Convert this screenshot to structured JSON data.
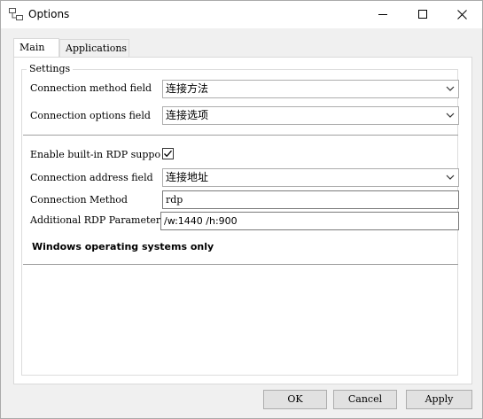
{
  "window": {
    "title": "Options"
  },
  "tabs": [
    {
      "label": "Main"
    },
    {
      "label": "Applications"
    }
  ],
  "settings": {
    "group_title": "Settings",
    "connection_method_field": {
      "label": "Connection method field",
      "value": "连接方法"
    },
    "connection_options_field": {
      "label": "Connection options field",
      "value": "连接选项"
    },
    "enable_rdp": {
      "label": "Enable built-in RDP suppo",
      "checked": true
    },
    "connection_address_field": {
      "label": "Connection address field",
      "value": "连接地址"
    },
    "connection_method": {
      "label": "Connection Method",
      "value": "rdp"
    },
    "additional_rdp_parameter": {
      "label": "Additional RDP Parameter",
      "value": "/w:1440 /h:900"
    },
    "note": "Windows operating systems only"
  },
  "buttons": {
    "ok": "OK",
    "cancel": "Cancel",
    "apply": "Apply"
  },
  "icons": {
    "app": "options-app-icon",
    "minimize": "minimize-icon",
    "maximize": "maximize-icon",
    "close": "close-icon",
    "dropdown": "chevron-down-icon",
    "check": "checkmark-icon"
  }
}
